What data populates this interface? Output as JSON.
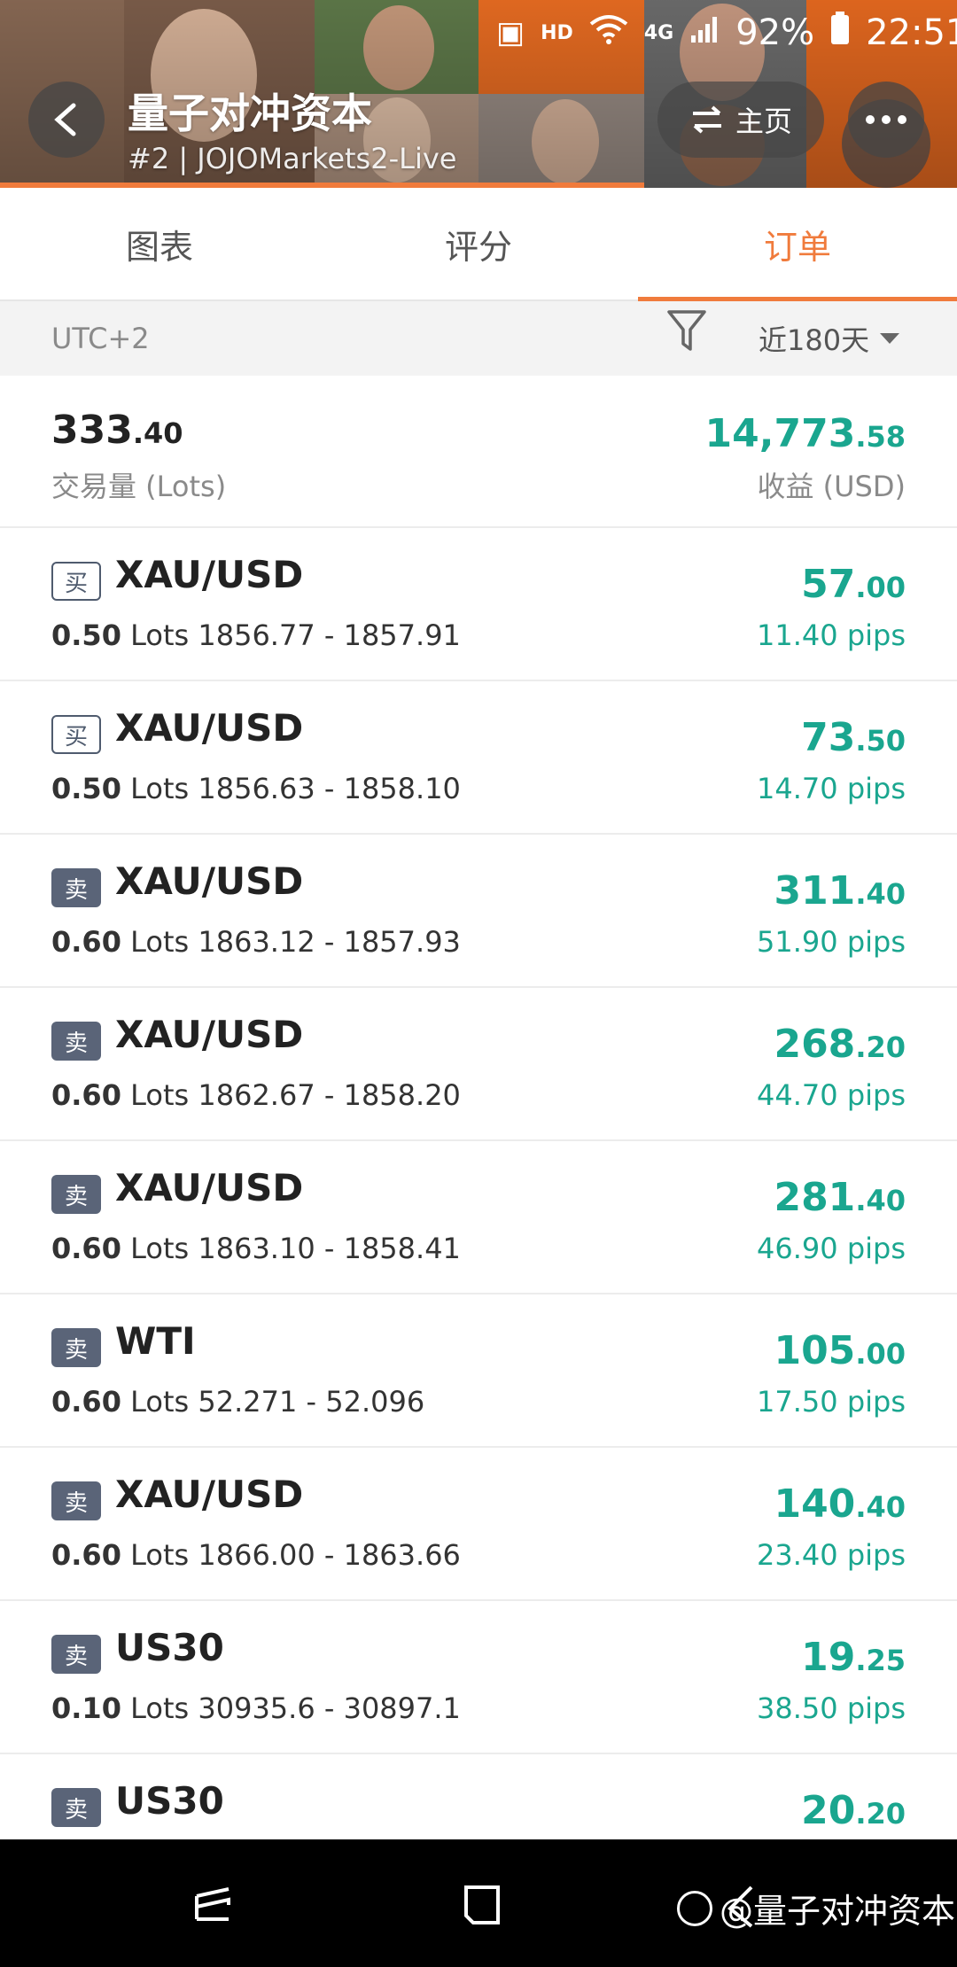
{
  "status_bar": {
    "hd": "HD",
    "network": "4G",
    "battery": "92%",
    "time": "22:51"
  },
  "header": {
    "title": "量子对冲资本",
    "subtitle": "#2 | JOJOMarkets2-Live",
    "home_label": "主页"
  },
  "tabs": [
    {
      "label": "图表",
      "active": false
    },
    {
      "label": "评分",
      "active": false
    },
    {
      "label": "订单",
      "active": true
    }
  ],
  "filter": {
    "timezone": "UTC+2",
    "range": "近180天"
  },
  "summary": {
    "lots_int": "333",
    "lots_dec": ".40",
    "lots_label": "交易量 (Lots)",
    "profit_int": "14,773",
    "profit_dec": ".58",
    "profit_label": "收益 (USD)"
  },
  "lots_unit": "Lots",
  "orders": [
    {
      "side": "买",
      "type": "buy",
      "symbol": "XAU/USD",
      "lots": "0.50",
      "prices": "1856.77 - 1857.91",
      "profit_int": "57",
      "profit_dec": ".00",
      "pips": "11.40 pips"
    },
    {
      "side": "买",
      "type": "buy",
      "symbol": "XAU/USD",
      "lots": "0.50",
      "prices": "1856.63 - 1858.10",
      "profit_int": "73",
      "profit_dec": ".50",
      "pips": "14.70 pips"
    },
    {
      "side": "卖",
      "type": "sell",
      "symbol": "XAU/USD",
      "lots": "0.60",
      "prices": "1863.12 - 1857.93",
      "profit_int": "311",
      "profit_dec": ".40",
      "pips": "51.90 pips"
    },
    {
      "side": "卖",
      "type": "sell",
      "symbol": "XAU/USD",
      "lots": "0.60",
      "prices": "1862.67 - 1858.20",
      "profit_int": "268",
      "profit_dec": ".20",
      "pips": "44.70 pips"
    },
    {
      "side": "卖",
      "type": "sell",
      "symbol": "XAU/USD",
      "lots": "0.60",
      "prices": "1863.10 - 1858.41",
      "profit_int": "281",
      "profit_dec": ".40",
      "pips": "46.90 pips"
    },
    {
      "side": "卖",
      "type": "sell",
      "symbol": "WTI",
      "lots": "0.60",
      "prices": "52.271 - 52.096",
      "profit_int": "105",
      "profit_dec": ".00",
      "pips": "17.50 pips"
    },
    {
      "side": "卖",
      "type": "sell",
      "symbol": "XAU/USD",
      "lots": "0.60",
      "prices": "1866.00 - 1863.66",
      "profit_int": "140",
      "profit_dec": ".40",
      "pips": "23.40 pips"
    },
    {
      "side": "卖",
      "type": "sell",
      "symbol": "US30",
      "lots": "0.10",
      "prices": "30935.6 - 30897.1",
      "profit_int": "19",
      "profit_dec": ".25",
      "pips": "38.50 pips"
    },
    {
      "side": "卖",
      "type": "sell",
      "symbol": "US30",
      "lots": "",
      "prices": "",
      "profit_int": "20",
      "profit_dec": ".20",
      "pips": ""
    }
  ],
  "watermark": "@量子对冲资本",
  "colors": {
    "accent": "#f07b3c",
    "profit": "#1aa68f",
    "sell_badge": "#5a6478"
  }
}
